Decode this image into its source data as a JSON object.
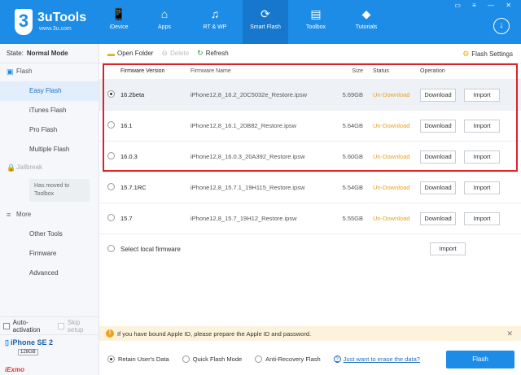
{
  "app": {
    "name": "3uTools",
    "url": "www.3u.com",
    "badge": "3"
  },
  "nav": [
    {
      "label": "iDevice",
      "icon": "📱"
    },
    {
      "label": "Apps",
      "icon": "⌂"
    },
    {
      "label": "RT & WP",
      "icon": "♫"
    },
    {
      "label": "Smart Flash",
      "icon": "⟳"
    },
    {
      "label": "Toolbox",
      "icon": "▤"
    },
    {
      "label": "Tutorials",
      "icon": "◆"
    }
  ],
  "window_controls": "▭ ≡ — ✕",
  "sidebar": {
    "state_label": "State:",
    "state_value": "Normal Mode",
    "flash_section": "Flash",
    "items": [
      "Easy Flash",
      "iTunes Flash",
      "Pro Flash",
      "Multiple Flash"
    ],
    "jailbreak_section": "Jailbreak",
    "jailbreak_note": "Has moved to Toolbox",
    "more_section": "More",
    "more_items": [
      "Other Tools",
      "Firmware",
      "Advanced"
    ],
    "auto_activation": "Auto-activation",
    "skip_setup": "Skip setup",
    "device_name": "iPhone SE 2",
    "capacity": "128GB",
    "brand": "iExmo"
  },
  "toolbar": {
    "open_folder": "Open Folder",
    "delete": "Delete",
    "refresh": "Refresh",
    "flash_settings": "Flash Settings"
  },
  "table": {
    "headers": {
      "version": "Firmware Version",
      "name": "Firmware Name",
      "size": "Size",
      "status": "Status",
      "operation": "Operation"
    },
    "rows": [
      {
        "version": "16.2beta",
        "name": "iPhone12,8_16.2_20C5032e_Restore.ipsw",
        "size": "5.69GB",
        "status": "Un-Download",
        "download": "Download",
        "import": "Import"
      },
      {
        "version": "16.1",
        "name": "iPhone12,8_16.1_20B82_Restore.ipsw",
        "size": "5.64GB",
        "status": "Un-Download",
        "download": "Download",
        "import": "Import"
      },
      {
        "version": "16.0.3",
        "name": "iPhone12,8_16.0.3_20A392_Restore.ipsw",
        "size": "5.60GB",
        "status": "Un-Download",
        "download": "Download",
        "import": "Import"
      },
      {
        "version": "15.7.1RC",
        "name": "iPhone12,8_15.7.1_19H115_Restore.ipsw",
        "size": "5.54GB",
        "status": "Un-Download",
        "download": "Download",
        "import": "Import"
      },
      {
        "version": "15.7",
        "name": "iPhone12,8_15.7_19H12_Restore.ipsw",
        "size": "5.55GB",
        "status": "Un-Download",
        "download": "Download",
        "import": "Import"
      }
    ],
    "selected_row": 0,
    "local_label": "Select local firmware",
    "local_import": "Import"
  },
  "warning": "If you have bound Apple ID, please prepare the Apple ID and password.",
  "footer": {
    "options": [
      "Retain User's Data",
      "Quick Flash Mode",
      "Anti-Recovery Flash"
    ],
    "selected_option": 0,
    "erase_link": "Just want to erase the data?",
    "flash_button": "Flash"
  },
  "colors": {
    "brand": "#1c8ce6",
    "status": "#e8a020",
    "highlight": "#d9232d"
  }
}
